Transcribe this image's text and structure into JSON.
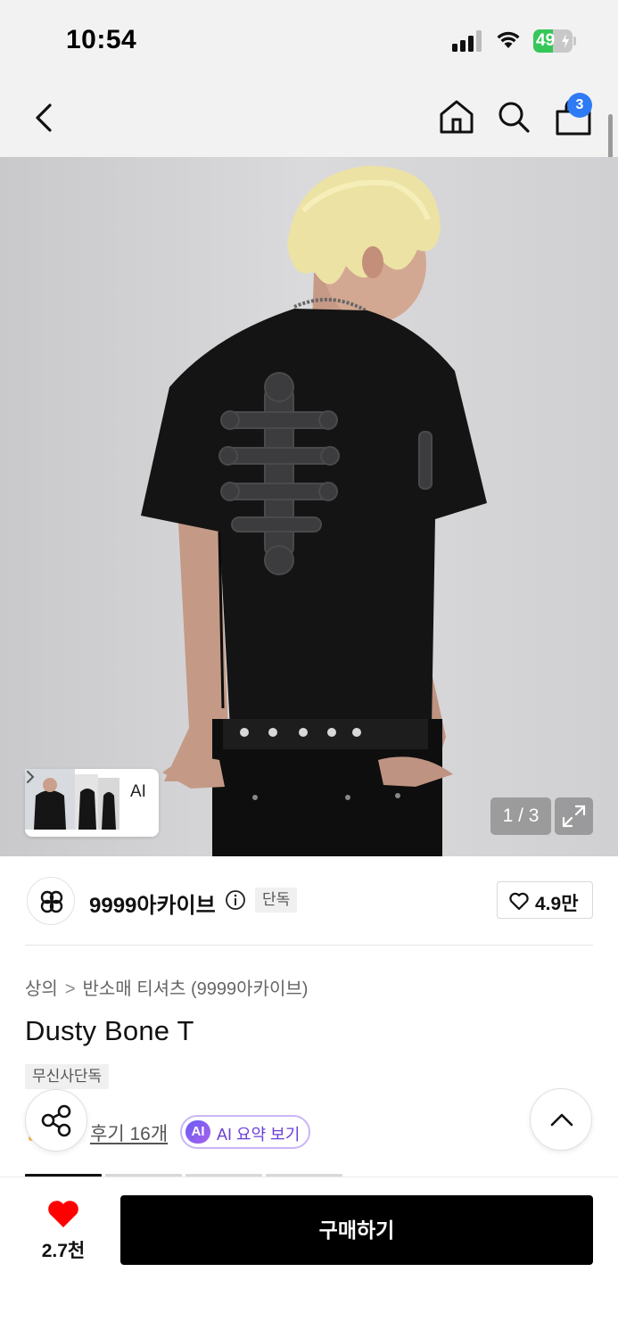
{
  "status_bar": {
    "time": "10:54",
    "battery_level": "49",
    "battery_fraction": 0.49,
    "icons": [
      "cellular-signal-icon",
      "wifi-icon",
      "battery-charging-icon"
    ]
  },
  "header": {
    "icons": [
      "back-arrow-icon",
      "home-icon",
      "search-icon",
      "shopping-bag-icon"
    ],
    "cart_count": "3"
  },
  "gallery": {
    "ai_label": "AI",
    "page_counter": "1 / 3"
  },
  "brand": {
    "name": "9999아카이브",
    "tag": "단독",
    "like_count": "4.9만"
  },
  "product": {
    "breadcrumb": [
      "상의",
      "반소매 티셔츠 (9999아카이브)"
    ],
    "title": "Dusty Bone T",
    "tag": "무신사단독",
    "review_link": "후기 16개",
    "ai_badge": "AI",
    "ai_summary_label": "AI 요약 보기"
  },
  "bottom_bar": {
    "wish_count": "2.7천",
    "buy_label": "구매하기"
  },
  "colors": {
    "accent_blue": "#2f7bf5",
    "heart_red": "#ff0000",
    "ai_purple": "#6a3fd8",
    "battery_green": "#35c759"
  }
}
